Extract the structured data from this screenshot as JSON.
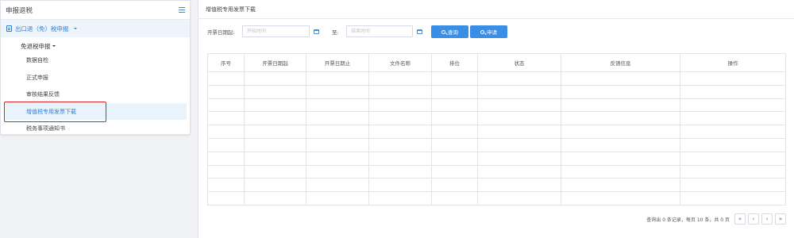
{
  "sidebar": {
    "title": "申报退税",
    "section": "出口退（免）税申报",
    "group": "免退税申报",
    "items": [
      {
        "label": "数据自检"
      },
      {
        "label": "正式申报"
      },
      {
        "label": "审核结果反馈"
      },
      {
        "label": "增值税专用发票下载"
      },
      {
        "label": "税务事项通知书"
      }
    ],
    "active_index": 3
  },
  "main": {
    "title": "增值税专用发票下载",
    "filter": {
      "start_label": "开票日期起:",
      "start_placeholder": "开始时间",
      "to_label": "至:",
      "end_placeholder": "结束时间",
      "query_button": "查询",
      "apply_button": "申请"
    },
    "table": {
      "columns": [
        "序号",
        "开票日期起",
        "开票日期止",
        "文件名称",
        "排位",
        "状态",
        "反馈信息",
        "操作"
      ],
      "rows": []
    },
    "pagination": {
      "info": "查询出 0 条记录，每页 10 条，共 0 页",
      "first": "«",
      "prev": "‹",
      "next": "›",
      "last": "»"
    }
  },
  "colors": {
    "accent": "#3a8ee6",
    "highlight_border": "#e02020"
  },
  "icons": [
    "menu-icon",
    "document-icon",
    "calendar-icon",
    "search-icon"
  ]
}
